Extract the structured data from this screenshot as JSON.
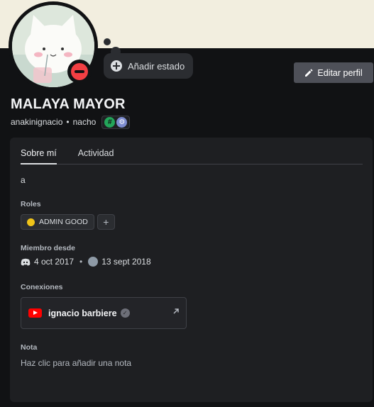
{
  "profile": {
    "display_name": "MALAYA MAYOR",
    "username": "anakinignacio",
    "separator": "•",
    "pronouns": "nacho",
    "badge_hash_glyph": "#",
    "badge_gear_glyph": "⚙",
    "status": "dnd",
    "status_color": "#f23f43",
    "banner_color": "#f2eedf"
  },
  "actions": {
    "add_status_label": "Añadir estado",
    "edit_profile_label": "Editar perfil"
  },
  "tabs": [
    {
      "label": "Sobre mí",
      "active": true
    },
    {
      "label": "Actividad",
      "active": false
    }
  ],
  "about": {
    "text": "a"
  },
  "roles": {
    "title": "Roles",
    "items": [
      {
        "name": "ADMIN GOOD",
        "color": "#f0c419"
      }
    ],
    "add_glyph": "+"
  },
  "member_since": {
    "title": "Miembro desde",
    "discord_date": "4 oct 2017",
    "separator": "•",
    "server_date": "13 sept 2018"
  },
  "connections": {
    "title": "Conexiones",
    "items": [
      {
        "platform": "youtube",
        "name": "ignacio barbiere",
        "verified_glyph": "✓"
      }
    ]
  },
  "note": {
    "title": "Nota",
    "placeholder": "Haz clic para añadir una nota"
  },
  "icons": {
    "status": "dnd-status-icon",
    "add_status": "plus-circle-icon",
    "edit": "pencil-icon",
    "discord": "discord-icon",
    "server": "server-icon",
    "youtube": "youtube-icon",
    "verified": "verified-icon",
    "external": "external-link-icon"
  }
}
